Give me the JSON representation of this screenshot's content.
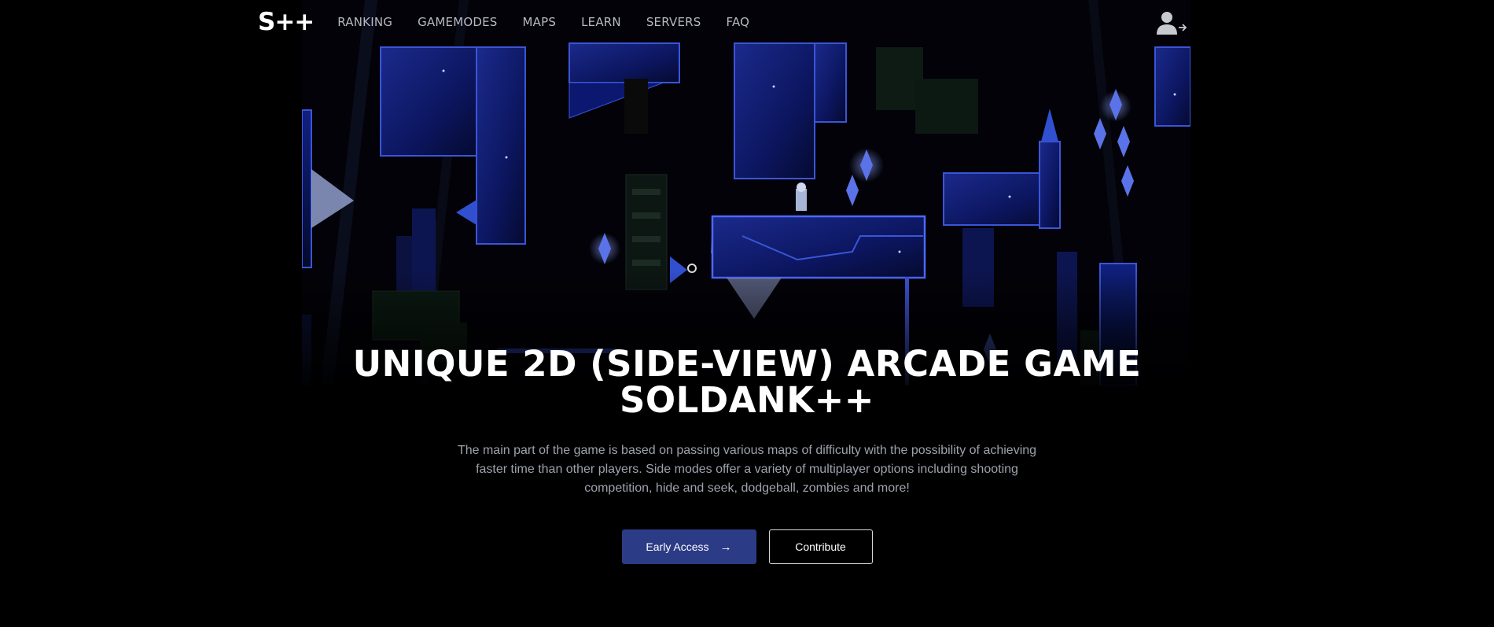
{
  "nav": {
    "logo": "S++",
    "links": [
      "RANKING",
      "GAMEMODES",
      "MAPS",
      "LEARN",
      "SERVERS",
      "FAQ"
    ],
    "user_icon": "user-login-icon"
  },
  "hero": {
    "title_line1": "UNIQUE 2D (SIDE-VIEW) ARCADE GAME",
    "title_line2": "SOLDANK++",
    "description": "The main part of the game is based on passing various maps of difficulty with the possibility of achieving faster time than other players. Side modes offer a variety of multiplayer options including shooting competition, hide and seek, dodgeball, zombies and more!",
    "primary_button": "Early Access",
    "primary_button_icon": "arrow-right-icon",
    "secondary_button": "Contribute"
  },
  "colors": {
    "background": "#000000",
    "accent": "#2c3b85",
    "nav_text": "#b7bac4",
    "body_text": "#9ea2ad"
  }
}
